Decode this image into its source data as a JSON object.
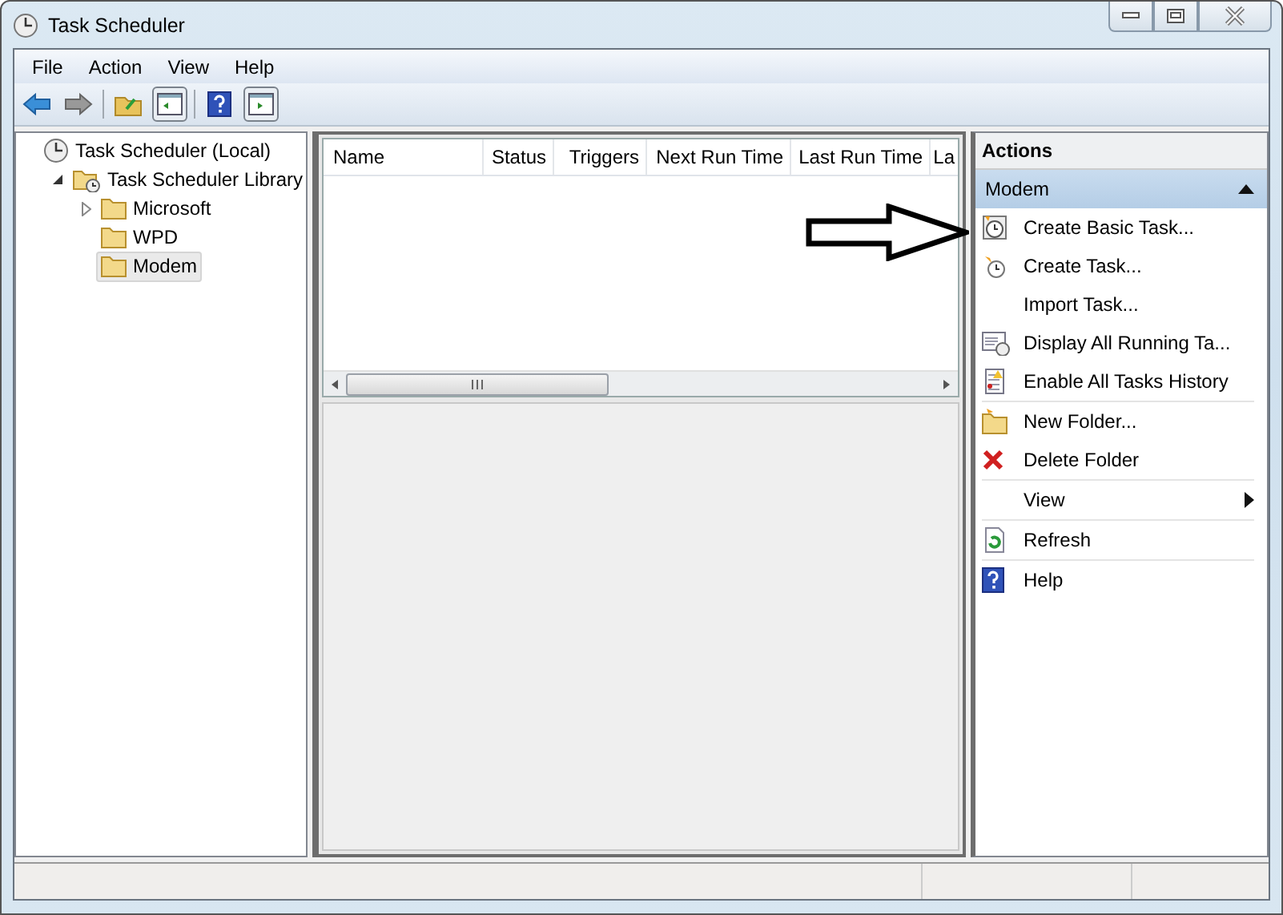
{
  "window": {
    "title": "Task Scheduler"
  },
  "menu": [
    "File",
    "Action",
    "View",
    "Help"
  ],
  "tree": [
    {
      "label": "Task Scheduler (Local)",
      "kind": "clock",
      "selected": false,
      "children": [
        {
          "label": "Task Scheduler Library",
          "kind": "folder-clock",
          "expanded": true,
          "selected": false,
          "children": [
            {
              "label": "Microsoft",
              "kind": "folder",
              "expanded": false,
              "selected": false
            },
            {
              "label": "WPD",
              "kind": "folder",
              "selected": false
            },
            {
              "label": "Modem",
              "kind": "folder",
              "selected": true
            }
          ]
        }
      ]
    }
  ],
  "table": {
    "columns": [
      "Name",
      "Status",
      "Triggers",
      "Next Run Time",
      "Last Run Time",
      "La"
    ]
  },
  "actions": {
    "title": "Actions",
    "section": {
      "title": "Modem",
      "expanded": true
    },
    "groups": [
      [
        {
          "label": "Create Basic Task...",
          "kind": "basic-task",
          "submenu": false
        },
        {
          "label": "Create Task...",
          "kind": "task",
          "submenu": false
        },
        {
          "label": "Import Task...",
          "kind": "none",
          "submenu": false
        },
        {
          "label": "Display All Running Ta...",
          "kind": "running",
          "submenu": false
        },
        {
          "label": "Enable All Tasks History",
          "kind": "history",
          "submenu": false
        }
      ],
      [
        {
          "label": "New Folder...",
          "kind": "new-folder",
          "submenu": false
        },
        {
          "label": "Delete Folder",
          "kind": "delete",
          "submenu": false
        }
      ],
      [
        {
          "label": "View",
          "kind": "none",
          "submenu": true
        }
      ],
      [
        {
          "label": "Refresh",
          "kind": "refresh",
          "submenu": false
        }
      ],
      [
        {
          "label": "Help",
          "kind": "help",
          "submenu": false
        }
      ]
    ]
  }
}
